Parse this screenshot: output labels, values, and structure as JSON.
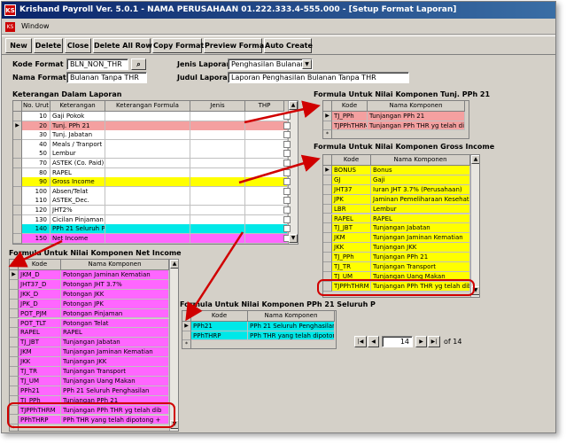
{
  "window": {
    "title": "Krishand Payroll Ver. 5.0.1 - NAMA PERUSAHAAN 01.222.333.4-555.000 - [Setup Format Laporan]",
    "app_icon_text": "KS"
  },
  "menu": {
    "window": "Window"
  },
  "toolbar": {
    "new": "New",
    "delete": "Delete",
    "close": "Close",
    "delete_all": "Delete All Row",
    "copy": "Copy Format",
    "preview": "Preview Format",
    "auto": "Auto Create"
  },
  "form": {
    "kode_format_label": "Kode Format",
    "kode_format_value": "BLN_NON_THR",
    "nama_format_label": "Nama Format",
    "nama_format_value": "Bulanan Tanpa THR",
    "jenis_laporan_label": "Jenis Laporan",
    "jenis_laporan_value": "Penghasilan Bulanan",
    "judul_laporan_label": "Judul Laporan",
    "judul_laporan_value": "Laporan Penghasilan Bulanan Tanpa THR"
  },
  "keterangan": {
    "title": "Keterangan Dalam Laporan",
    "headers": [
      "No. Urut",
      "Keterangan",
      "Keterangan Formula",
      "Jenis",
      "THP"
    ],
    "rows": [
      {
        "no": "10",
        "ket": "Gaji Pokok",
        "bg": "#ffffff"
      },
      {
        "no": "20",
        "ket": "Tunj. PPh 21",
        "bg": "#f4a0a0"
      },
      {
        "no": "30",
        "ket": "Tunj. Jabatan",
        "bg": "#ffffff"
      },
      {
        "no": "40",
        "ket": "Meals / Tranport",
        "bg": "#ffffff"
      },
      {
        "no": "50",
        "ket": "Lembur",
        "bg": "#ffffff"
      },
      {
        "no": "70",
        "ket": "ASTEK (Co. Paid)",
        "bg": "#ffffff"
      },
      {
        "no": "80",
        "ket": "RAPEL",
        "bg": "#ffffff"
      },
      {
        "no": "90",
        "ket": "Gross Income",
        "bg": "#ffff00"
      },
      {
        "no": "100",
        "ket": "Absen/Telat",
        "bg": "#ffffff"
      },
      {
        "no": "110",
        "ket": "ASTEK_Dec.",
        "bg": "#ffffff"
      },
      {
        "no": "120",
        "ket": "JHT2%",
        "bg": "#ffffff"
      },
      {
        "no": "130",
        "ket": "Cicilan Pinjaman",
        "bg": "#ffffff"
      },
      {
        "no": "140",
        "ket": "PPh 21 Seluruh Penghasilan",
        "bg": "#00e8e8"
      },
      {
        "no": "150",
        "ket": "Net Income",
        "bg": "#ff66ff"
      }
    ]
  },
  "tunj_pph": {
    "title": "Formula Untuk Nilai Komponen Tunj. PPh 21",
    "headers": [
      "Kode",
      "Nama Komponen"
    ],
    "rows": [
      {
        "kode": "TJ_PPh",
        "nama": "Tunjangan PPh 21"
      },
      {
        "kode": "TJPPhTHRM",
        "nama": "Tunjangan PPh THR yg telah dib"
      }
    ],
    "new_marker": "*"
  },
  "gross": {
    "title": "Formula Untuk Nilai Komponen Gross Income",
    "headers": [
      "Kode",
      "Nama Komponen"
    ],
    "rows": [
      {
        "kode": "BONUS",
        "nama": "Bonus"
      },
      {
        "kode": "GJ",
        "nama": "Gaji"
      },
      {
        "kode": "JHT37",
        "nama": "Iuran JHT 3.7% (Perusahaan)"
      },
      {
        "kode": "JPK",
        "nama": "Jaminan Pemeliharaan Kesehata"
      },
      {
        "kode": "LBR",
        "nama": "Lembur"
      },
      {
        "kode": "RAPEL",
        "nama": "RAPEL"
      },
      {
        "kode": "TJ_JBT",
        "nama": "Tunjangan Jabatan"
      },
      {
        "kode": "JKM",
        "nama": "Tunjangan Jaminan Kematian"
      },
      {
        "kode": "JKK",
        "nama": "Tunjangan JKK"
      },
      {
        "kode": "TJ_PPh",
        "nama": "Tunjangan PPh 21"
      },
      {
        "kode": "TJ_TR",
        "nama": "Tunjangan Transport"
      },
      {
        "kode": "TJ_UM",
        "nama": "Tunjangan Uang Makan"
      },
      {
        "kode": "TJPPhTHRM",
        "nama": "Tunjangan PPh THR yg telah dib"
      }
    ],
    "nav_first": "|◀",
    "nav_prev": "◀",
    "nav_current": "14",
    "nav_next": "▶",
    "nav_last": "▶|",
    "nav_of": "of 14"
  },
  "net": {
    "title": "Formula Untuk Nilai Komponen Net Income",
    "headers": [
      "Kode",
      "Nama Komponen"
    ],
    "rows": [
      {
        "kode": "JKM_D",
        "nama": "Potongan Jaminan Kematian"
      },
      {
        "kode": "JHT37_D",
        "nama": "Potongan JHT 3.7%"
      },
      {
        "kode": "JKK_D",
        "nama": "Potongan JKK"
      },
      {
        "kode": "JPK_D",
        "nama": "Potongan JPK"
      },
      {
        "kode": "POT_PJM",
        "nama": "Potongan Pinjaman"
      },
      {
        "kode": "POT_TLT",
        "nama": "Potongan Telat"
      },
      {
        "kode": "RAPEL",
        "nama": "RAPEL"
      },
      {
        "kode": "TJ_JBT",
        "nama": "Tunjangan Jabatan"
      },
      {
        "kode": "JKM",
        "nama": "Tunjangan Jaminan Kematian"
      },
      {
        "kode": "JKK",
        "nama": "Tunjangan JKK"
      },
      {
        "kode": "TJ_TR",
        "nama": "Tunjangan Transport"
      },
      {
        "kode": "TJ_UM",
        "nama": "Tunjangan Uang Makan"
      },
      {
        "kode": "PPh21",
        "nama": "PPh 21 Seluruh Penghasilan"
      },
      {
        "kode": "TJ_PPh",
        "nama": "Tunjangan PPh 21"
      },
      {
        "kode": "TJPPhTHRM",
        "nama": "Tunjangan PPh THR yg telah dib"
      },
      {
        "kode": "PPhTHRP",
        "nama": "PPh THR yang telah dipotong +"
      }
    ],
    "new_marker": "*"
  },
  "pph_seluruh": {
    "title": "Formula Untuk Nilai Komponen PPh 21 Seluruh P",
    "headers": [
      "Kode",
      "Nama Komponen"
    ],
    "rows": [
      {
        "kode": "PPh21",
        "nama": "PPh 21 Seluruh Penghasilan"
      },
      {
        "kode": "PPhTHRP",
        "nama": "PPh THR yang telah dipotong +"
      }
    ],
    "new_marker": "*"
  },
  "colors": {
    "pink_row": "#f4a0a0",
    "yellow_panel": "#ffff00",
    "magenta_panel": "#ff66ff",
    "cyan_panel": "#00e8e8",
    "highlight_red": "#d00000"
  }
}
